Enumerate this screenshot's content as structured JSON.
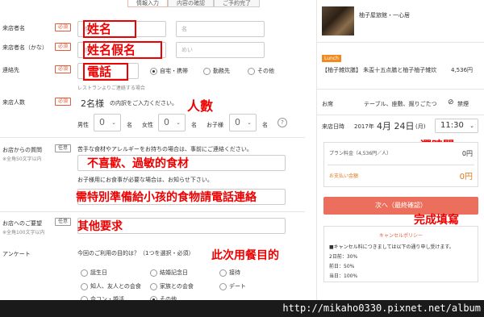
{
  "steps": [
    "情報入力",
    "内容の確認",
    "ご予約完了"
  ],
  "form": {
    "name": {
      "label": "来店者名",
      "req": "必須",
      "ph1": "姓",
      "ph2": "名",
      "ann": "姓名"
    },
    "kana": {
      "label": "来店者名（かな）",
      "req": "必須",
      "ph1": "せい",
      "ph2": "めい",
      "ann": "姓名假名"
    },
    "contact": {
      "label": "連絡先",
      "req": "必須",
      "options": [
        "自宅・携帯",
        "勤務先",
        "その他"
      ],
      "hint": "レストランよりご連絡する場合",
      "ann": "電話"
    },
    "people": {
      "label": "来店人数",
      "req": "必須",
      "summary_a": "2名様",
      "summary_b": "の内訳をご入力ください。",
      "ann": "人數",
      "male": "男性",
      "female": "女性",
      "child": "お子様",
      "unit": "名",
      "male_v": "0",
      "female_v": "0",
      "child_v": "0",
      "help": "?"
    },
    "question": {
      "label": "お店からの質問",
      "sub": "※全角50文字以内",
      "opt": "任意",
      "q1": "苦手な食材やアレルギーをお持ちの場合は、事前にご連絡ください。",
      "a1": "不喜歡、過敏的食材",
      "q2": "お子様用にお食事が必要な場合は、お知らせ下さい。",
      "a2": "需特別準備給小孩的食物請電話連絡"
    },
    "request": {
      "label": "お店へのご要望",
      "sub": "※全角100文字以内",
      "opt": "任意",
      "ann": "其他要求"
    },
    "survey": {
      "label": "アンケート",
      "q": "今回のご利用の目的は？（1つを選択・必須）",
      "ann": "此次用餐目的",
      "opts": [
        "誕生日",
        "結婚記念日",
        "接待",
        "知人、友人との会食",
        "家族との会食",
        "デート",
        "合コン・婚活",
        "その他"
      ]
    }
  },
  "panel": {
    "restaurant": "柚子屋旅館・一心居",
    "badge": "Lunch",
    "plan": "【柚子雑炊膳】 朱盃十五点膳と柚子柚子雑炊",
    "plan_price": "4,536円",
    "seat_label": "お席",
    "seat_value": "テーブル、座敷、掘りごたつ",
    "smoke": "禁煙",
    "date_label": "来店日時",
    "date_year": "2017年",
    "date_md": "4月 24日",
    "date_dow": "(月)",
    "time": "11:30",
    "ann_time": "選時間",
    "plan_fee": "プラン料金（4,536円／人）",
    "plan_fee_val": "0円",
    "pay_label": "お支払い金額",
    "pay_val": "0円",
    "next": "次へ（最終確認）",
    "ann_next": "完成填寫",
    "cancel_title": "キャンセルポリシー",
    "cancel_text": "■キャンセル料につきましては以下の通り申し受けます。",
    "c1": "2日前：30%",
    "c2": "前日：50%",
    "c3": "当日：100%"
  },
  "watermark": "http://mikaho0330.pixnet.net/album"
}
